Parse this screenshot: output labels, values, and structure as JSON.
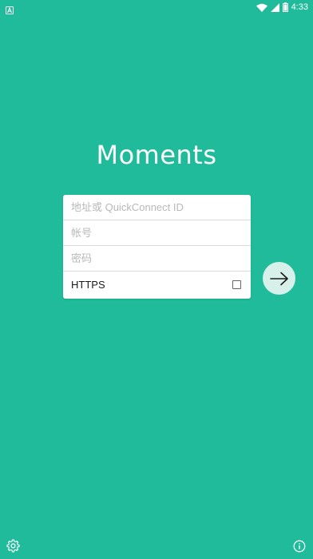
{
  "status_bar": {
    "time": "4:33",
    "icons": [
      "app-notification-icon",
      "wifi-icon",
      "cellular-signal-icon",
      "battery-icon"
    ]
  },
  "app": {
    "title": "Moments"
  },
  "login_form": {
    "address_placeholder": "地址或 QuickConnect ID",
    "address_value": "",
    "account_placeholder": "帐号",
    "account_value": "",
    "password_placeholder": "密码",
    "password_value": "",
    "https_label": "HTTPS",
    "https_checked": false
  },
  "actions": {
    "submit_icon": "arrow-right-icon",
    "settings_icon": "gear-icon",
    "info_icon": "info-icon"
  },
  "colors": {
    "background": "#1fbb9a",
    "card": "#ffffff",
    "submit_button": "#d7f1ea",
    "text_white": "#ffffff"
  }
}
